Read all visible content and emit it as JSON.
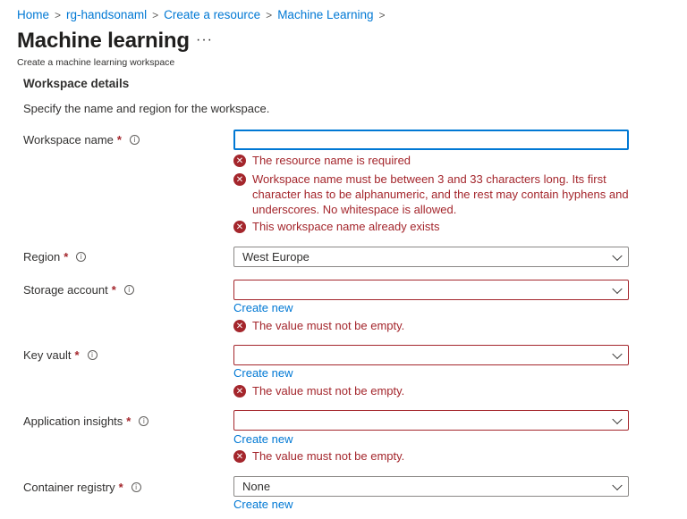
{
  "breadcrumb": {
    "items": [
      "Home",
      "rg-handsonaml",
      "Create a resource",
      "Machine Learning"
    ],
    "separator": ">"
  },
  "header": {
    "title": "Machine learning",
    "more_label": "···",
    "subtitle": "Create a machine learning workspace"
  },
  "section": {
    "title": "Workspace details",
    "description": "Specify the name and region for the workspace."
  },
  "fields": {
    "workspace_name": {
      "label": "Workspace name",
      "value": "",
      "errors": [
        "The resource name is required",
        "Workspace name must be between 3 and 33 characters long. Its first character has to be alphanumeric, and the rest may contain hyphens and underscores. No whitespace is allowed.",
        "This workspace name already exists"
      ]
    },
    "region": {
      "label": "Region",
      "value": "West Europe"
    },
    "storage_account": {
      "label": "Storage account",
      "value": "",
      "link": "Create new",
      "error": "The value must not be empty."
    },
    "key_vault": {
      "label": "Key vault",
      "value": "",
      "link": "Create new",
      "error": "The value must not be empty."
    },
    "application_insights": {
      "label": "Application insights",
      "value": "",
      "link": "Create new",
      "error": "The value must not be empty."
    },
    "container_registry": {
      "label": "Container registry",
      "value": "None",
      "link": "Create new"
    }
  },
  "common": {
    "required_mark": "*",
    "info_glyph": "i",
    "error_glyph": "✕"
  },
  "colors": {
    "link": "#0078d4",
    "error": "#a4262c",
    "focus": "#0078d4",
    "text": "#323130"
  }
}
